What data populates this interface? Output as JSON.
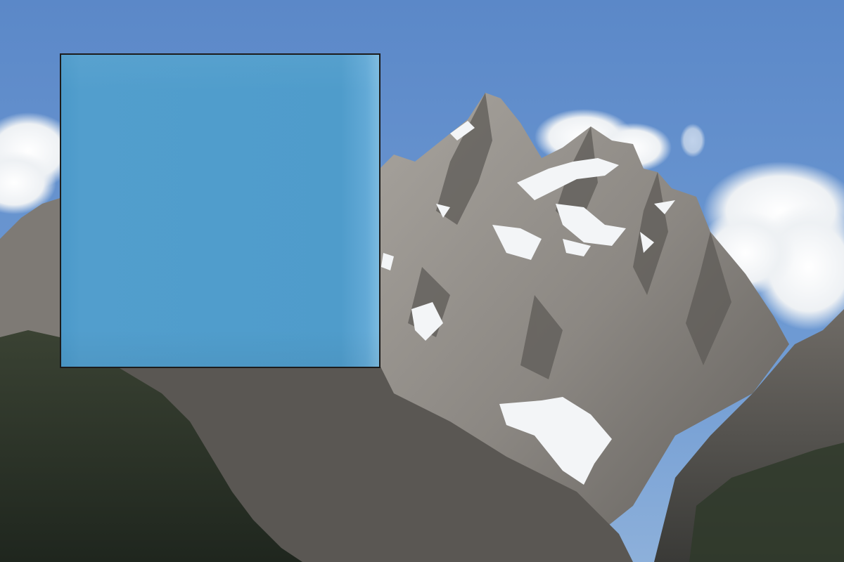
{
  "scene": {
    "subject": "snow-capped-mountain-peak",
    "sky_color": "#5f8fcd",
    "rock_color": "#8c8a86",
    "snow_color": "#f3f5f7",
    "forest_color": "#2c3529",
    "cloud_color": "#f1f3f5"
  },
  "overlay": {
    "fill_color": "#4f9dcc",
    "border_color": "#1c1c1c"
  }
}
